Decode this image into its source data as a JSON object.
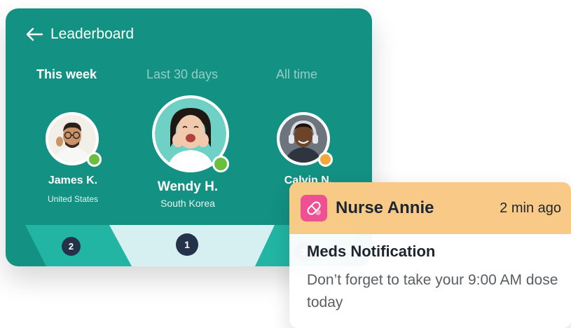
{
  "leaderboard": {
    "title": "Leaderboard",
    "tabs": [
      {
        "label": "This week",
        "active": true
      },
      {
        "label": "Last 30 days",
        "active": false
      },
      {
        "label": "All time",
        "active": false
      }
    ],
    "players": [
      {
        "name": "James K.",
        "country": "United States",
        "rank": "2",
        "status_color": "#6abf3f"
      },
      {
        "name": "Wendy H.",
        "country": "South Korea",
        "rank": "1",
        "status_color": "#6abf3f"
      },
      {
        "name": "Calvin N.",
        "country": "",
        "rank": "3",
        "status_color": "#f3a73a"
      }
    ],
    "colors": {
      "card": "#139183",
      "podium_side": "#22b5a3",
      "podium_center": "#d6eff0"
    }
  },
  "notification": {
    "sender": "Nurse Annie",
    "time": "2 min ago",
    "title": "Meds Notification",
    "body": "Don’t forget to take your 9:00 AM dose today",
    "icon": "pill-icon",
    "colors": {
      "header": "#f8be6c",
      "icon_bg": "#ef4f93"
    }
  }
}
